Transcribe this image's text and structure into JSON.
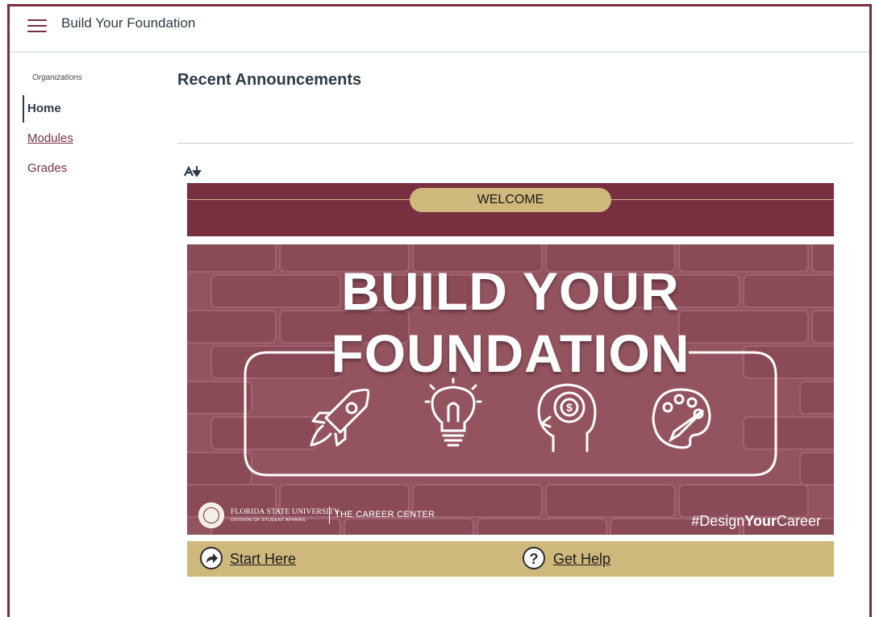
{
  "header": {
    "title": "Build Your Foundation",
    "menu_icon": "hamburger-menu-icon"
  },
  "sidebar": {
    "section_label": "Organizations",
    "items": [
      {
        "label": "Home",
        "active": true
      },
      {
        "label": "Modules",
        "active": false
      },
      {
        "label": "Grades",
        "active": false
      }
    ]
  },
  "main": {
    "title": "Recent Announcements",
    "a11y_icon": "alternative-formats-icon",
    "welcome_label": "WELCOME",
    "banner": {
      "headline_line1": "BUILD YOUR",
      "headline_line2": "FOUNDATION",
      "icons": [
        "rocket-icon",
        "lightbulb-icon",
        "head-money-icon",
        "paint-palette-icon"
      ],
      "university": "FLORIDA STATE UNIVERSITY",
      "division": "DIVISION OF STUDENT AFFAIRS",
      "career_center": "THE CAREER CENTER",
      "hashtag_pre": "#Design",
      "hashtag_bold": "Your",
      "hashtag_post": "Career"
    },
    "links": [
      {
        "label": "Start Here",
        "icon": "share-arrow-icon"
      },
      {
        "label": "Get Help",
        "icon": "question-mark-icon"
      }
    ]
  },
  "colors": {
    "garnet": "#782f40",
    "gold": "#cfb87c",
    "banner": "#94545f",
    "text": "#2d3b45"
  }
}
